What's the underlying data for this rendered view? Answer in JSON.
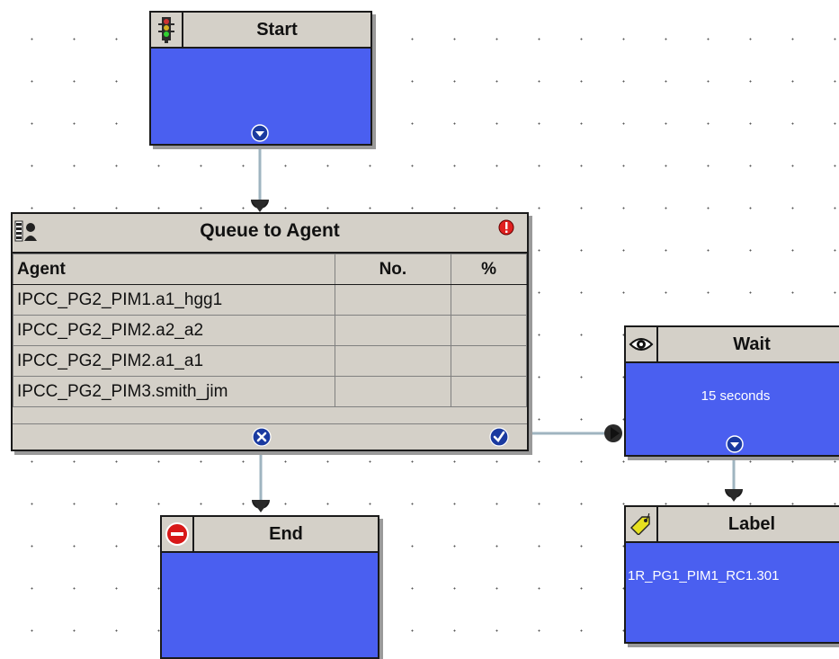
{
  "nodes": {
    "start": {
      "title": "Start",
      "icon": "traffic-light-icon"
    },
    "queue": {
      "title": "Queue to Agent",
      "icon": "queue-agent-icon",
      "columns": [
        "Agent",
        "No.",
        "%"
      ],
      "rows": [
        {
          "agent": "IPCC_PG2_PIM1.a1_hgg1",
          "num": "",
          "pct": ""
        },
        {
          "agent": "IPCC_PG2_PIM2.a2_a2",
          "num": "",
          "pct": ""
        },
        {
          "agent": "IPCC_PG2_PIM2.a1_a1",
          "num": "",
          "pct": ""
        },
        {
          "agent": "IPCC_PG2_PIM3.smith_jim",
          "num": "",
          "pct": ""
        }
      ]
    },
    "wait": {
      "title": "Wait",
      "icon": "eye-icon",
      "body": "15 seconds"
    },
    "end": {
      "title": "End",
      "icon": "stop-sign-icon"
    },
    "label": {
      "title": "Label",
      "icon": "label-tag-icon",
      "body": "1R_PG1_PIM1_RC1.301"
    }
  },
  "colors": {
    "node_body": "#4a5ff0",
    "header": "#d4d0c8",
    "connector": "#9fb4c0",
    "port": "#1a3aa0"
  }
}
